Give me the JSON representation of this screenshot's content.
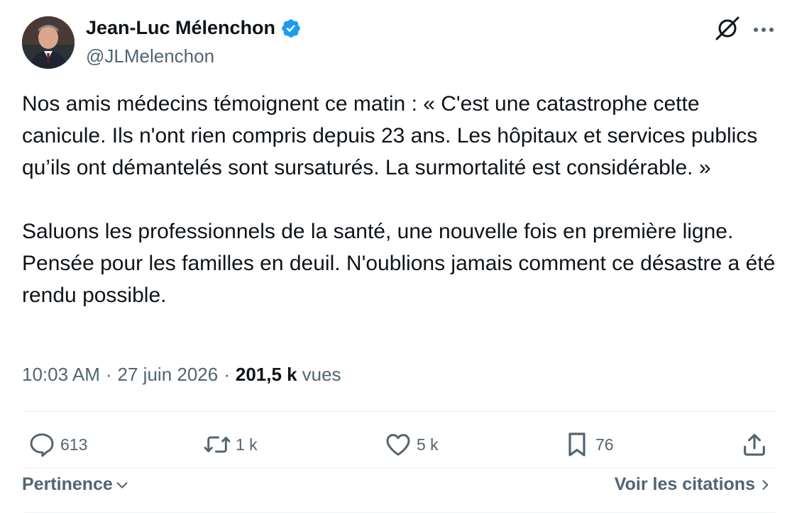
{
  "author": {
    "name": "Jean-Luc Mélenchon",
    "handle": "@JLMelenchon",
    "verified": true
  },
  "tweet": {
    "paragraph_1": "Nos amis médecins témoignent ce matin : « C'est une catastrophe cette canicule. Ils n'ont rien compris depuis 23 ans. Les hôpitaux et services publics qu’ils ont démantelés sont sursaturés. La surmortalité est considérable. »",
    "paragraph_2": "Saluons les professionnels de la santé, une nouvelle fois en première ligne. Pensée pour les familles en deuil. N'oublions jamais comment ce désastre a été rendu possible."
  },
  "meta": {
    "time": "10:03 AM",
    "separator": "·",
    "date": "27 juin 2026",
    "views_count": "201,5 k",
    "views_label": "vues"
  },
  "actions": {
    "replies": "613",
    "reposts": "1 k",
    "likes": "5 k",
    "bookmarks": "76"
  },
  "footer": {
    "sort_label": "Pertinence",
    "quotes_label": "Voir les citations"
  },
  "icons": {
    "verified": "verified-badge-icon",
    "grok": "grok-icon",
    "more": "more-icon",
    "reply": "reply-icon",
    "repost": "repost-icon",
    "like": "heart-icon",
    "bookmark": "bookmark-icon",
    "share": "share-icon",
    "sort_chevron": "chevron-down-icon",
    "quotes_chevron": "chevron-right-icon"
  },
  "colors": {
    "text_primary": "#0f1419",
    "text_secondary": "#536471",
    "verified_blue": "#1d9bf0",
    "divider": "#eff3f4"
  }
}
